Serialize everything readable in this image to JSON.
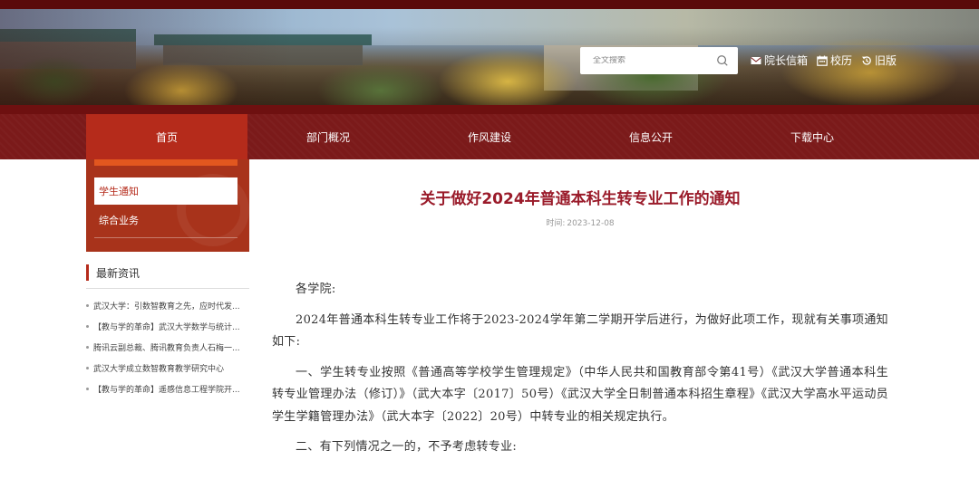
{
  "header": {
    "search": {
      "placeholder": "全文搜索"
    },
    "links": [
      {
        "label": "院长信箱",
        "icon": "mail-icon"
      },
      {
        "label": "校历",
        "icon": "calendar-icon"
      },
      {
        "label": "旧版",
        "icon": "history-icon"
      }
    ]
  },
  "nav": {
    "items": [
      {
        "label": "首页",
        "active": true
      },
      {
        "label": "部门概况"
      },
      {
        "label": "作风建设"
      },
      {
        "label": "信息公开"
      },
      {
        "label": "下载中心"
      }
    ]
  },
  "sidebar": {
    "menu": [
      {
        "label": "学生通知",
        "active": true
      },
      {
        "label": "综合业务"
      }
    ],
    "news_title": "最新资讯",
    "news": [
      "武汉大学：引数智教育之先，应时代发...",
      "【教与学的革命】武汉大学数学与统计...",
      "腾讯云副总裁、腾讯教育负责人石梅一...",
      "武汉大学成立数智教育教学研究中心",
      "【教与学的革命】遥感信息工程学院开..."
    ]
  },
  "article": {
    "title": "关于做好2024年普通本科生转专业工作的通知",
    "time_label": "时间:",
    "time_value": "2023-12-08",
    "paragraphs": [
      "各学院:",
      "2024年普通本科生转专业工作将于2023-2024学年第二学期开学后进行，为做好此项工作，现就有关事项通知如下:",
      "一、学生转专业按照《普通高等学校学生管理规定》（中华人民共和国教育部令第41号）《武汉大学普通本科生转专业管理办法（修订）》（武大本字〔2017〕50号）《武汉大学全日制普通本科招生章程》《武汉大学高水平运动员学生学籍管理办法》（武大本字〔2022〕20号）中转专业的相关规定执行。",
      "二、有下列情况之一的，不予考虑转专业:"
    ]
  },
  "colors": {
    "nav_bg": "#7b1a1a",
    "accent": "#b52b1b",
    "title": "#9a1b2a"
  }
}
